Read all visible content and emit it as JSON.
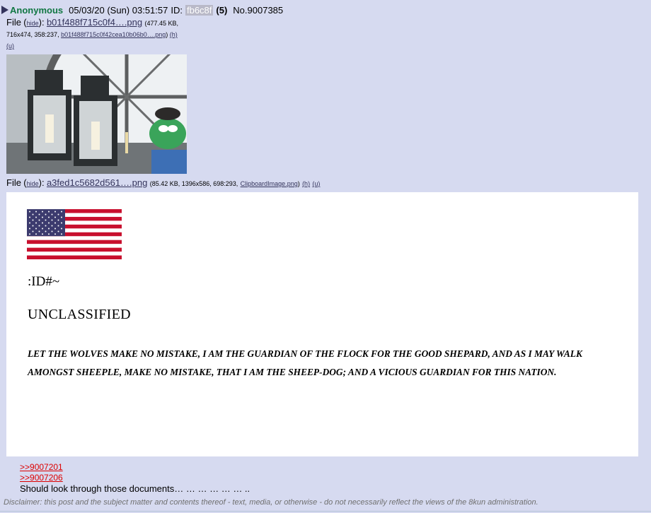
{
  "post": {
    "name": "Anonymous",
    "date": "05/03/20 (Sun) 03:51:57",
    "id_label": "ID:",
    "id_value": "fb6c8f",
    "id_count": "(5)",
    "number": "No.9007385"
  },
  "file1": {
    "label": "File",
    "hide": "hide",
    "colon": "):",
    "filename": "b01f488f715c0f4….png",
    "size_info": "(477.45 KB,",
    "dims": "716x474, 358:237,",
    "original_name": "b01f488f715c0f42cea10b06b0….png",
    "h": "(h)",
    "u": "(u)"
  },
  "file2": {
    "label": "File",
    "hide": "hide",
    "colon": "):",
    "filename": "a3fed1c5682d561….png",
    "info": "(85.42 KB, 1396x586, 698:293,",
    "original_name": "ClipboardImage.png",
    "h": "(h)",
    "u": "(u)"
  },
  "document": {
    "id_line": ":ID#~",
    "classification": "UNCLASSIFIED",
    "body": "LET THE WOLVES MAKE NO MISTAKE, I AM THE GUARDIAN OF THE FLOCK FOR THE GOOD SHEPARD, AND AS I MAY WALK AMONGST SHEEPLE, MAKE NO MISTAKE, THAT I AM THE SHEEP-DOG; AND A VICIOUS GUARDIAN FOR THIS NATION."
  },
  "replies": [
    ">>9007201",
    ">>9007206"
  ],
  "message": "Should look through those documents… … … … … … ..",
  "disclaimer": "Disclaimer: this post and the subject matter and contents thereof - text, media, or otherwise - do not necessarily reflect the views of the 8kun administration.",
  "colors": {
    "background": "#d6daf0",
    "name": "#117743",
    "link": "#34345c",
    "reply_link": "#dd0000"
  }
}
